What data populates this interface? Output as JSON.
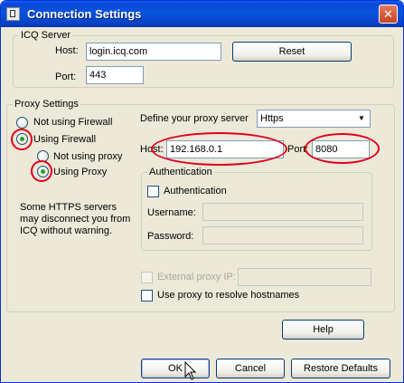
{
  "window": {
    "title": "Connection Settings",
    "close": "✕"
  },
  "icq_server": {
    "legend": "ICQ Server",
    "host_label": "Host:",
    "host_value": "login.icq.com",
    "port_label": "Port:",
    "port_value": "443",
    "reset_label": "Reset"
  },
  "proxy_settings": {
    "legend": "Proxy Settings",
    "not_using_firewall": "Not using Firewall",
    "using_firewall": "Using Firewall",
    "not_using_proxy": "Not using proxy",
    "using_proxy": "Using Proxy",
    "note": "Some HTTPS servers may disconnect you from ICQ without warning."
  },
  "proxy_server": {
    "define_label": "Define your proxy server",
    "type_value": "Https",
    "host_label": "Host:",
    "host_value": "192.168.0.1",
    "port_label": "Port:",
    "port_value": "8080"
  },
  "authentication": {
    "legend": "Authentication",
    "checkbox_label": "Authentication",
    "username_label": "Username:",
    "username_value": "",
    "password_label": "Password:",
    "password_value": ""
  },
  "external_ip": {
    "label": "External proxy IP:",
    "value": ""
  },
  "resolve_hostnames": {
    "label": "Use proxy to resolve hostnames"
  },
  "buttons": {
    "help": "Help",
    "ok": "OK",
    "cancel": "Cancel",
    "restore": "Restore Defaults"
  },
  "colors": {
    "highlight_ring": "#e0001b",
    "titlebar": "#0a46d8"
  }
}
